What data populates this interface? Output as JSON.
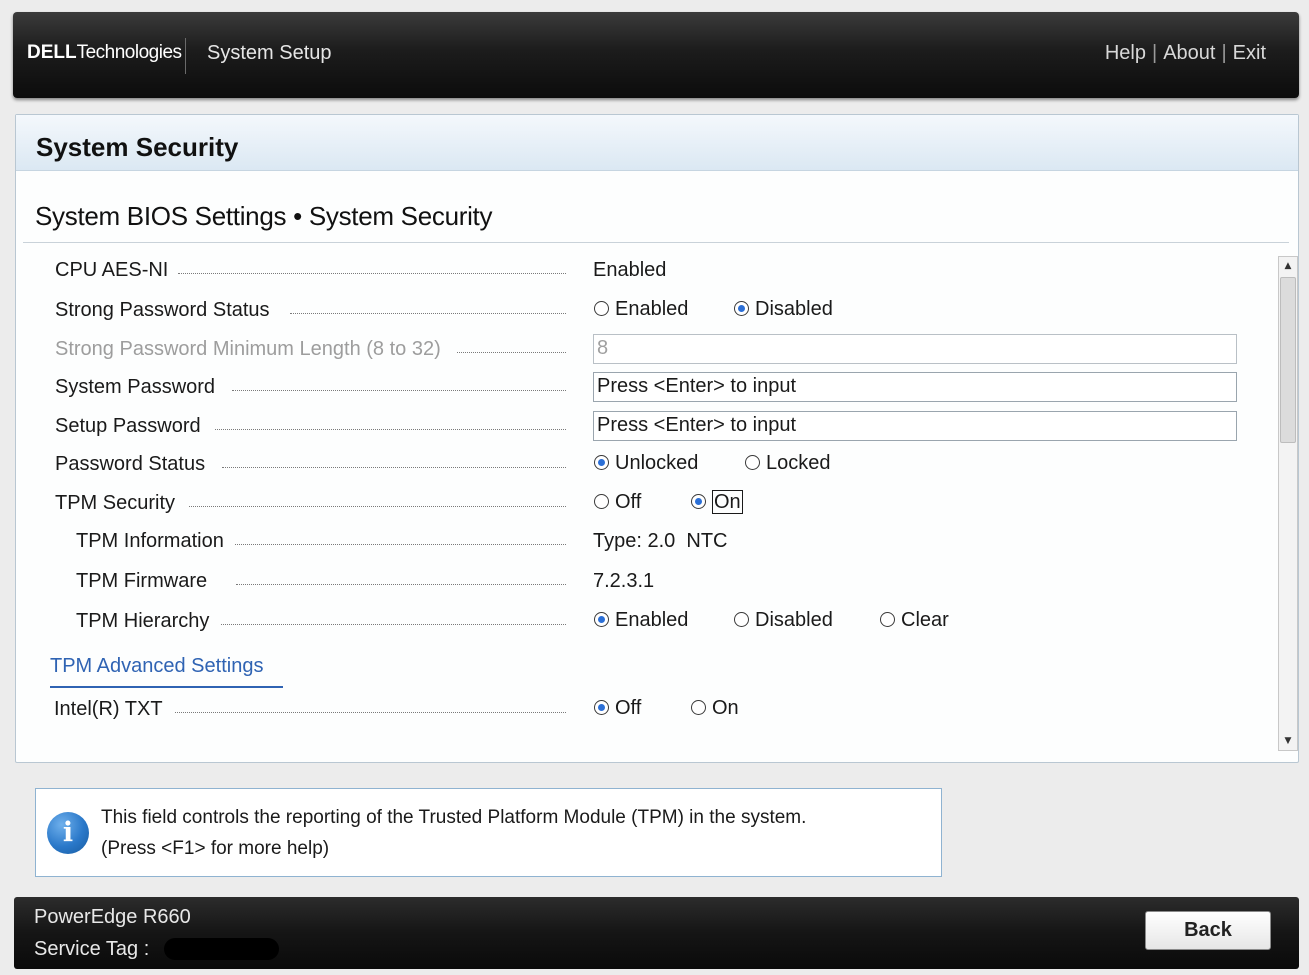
{
  "header": {
    "brand_bold": "DELL",
    "brand_rest": "Technologies",
    "app_title": "System Setup",
    "nav": {
      "help": "Help",
      "about": "About",
      "exit": "Exit",
      "separator": "|"
    }
  },
  "panel": {
    "title": "System Security",
    "breadcrumb": "System BIOS Settings • System Security"
  },
  "settings": {
    "cpu_aes_ni": {
      "label": "CPU AES-NI",
      "value": "Enabled"
    },
    "strong_password_status": {
      "label": "Strong Password Status",
      "options": [
        "Enabled",
        "Disabled"
      ],
      "selected": "Disabled"
    },
    "strong_password_min_length": {
      "label": "Strong Password Minimum Length (8 to 32)",
      "value": "8",
      "disabled": true
    },
    "system_password": {
      "label": "System Password",
      "value": "Press <Enter> to input"
    },
    "setup_password": {
      "label": "Setup Password",
      "value": "Press <Enter> to input"
    },
    "password_status": {
      "label": "Password Status",
      "options": [
        "Unlocked",
        "Locked"
      ],
      "selected": "Unlocked"
    },
    "tpm_security": {
      "label": "TPM Security",
      "options": [
        "Off",
        "On"
      ],
      "selected": "On"
    },
    "tpm_information": {
      "label": "TPM Information",
      "value": "Type: 2.0  NTC"
    },
    "tpm_firmware": {
      "label": "TPM Firmware",
      "value": "7.2.3.1"
    },
    "tpm_hierarchy": {
      "label": "TPM Hierarchy",
      "options": [
        "Enabled",
        "Disabled",
        "Clear"
      ],
      "selected": "Enabled"
    },
    "tpm_advanced_link": "TPM Advanced Settings",
    "intel_txt": {
      "label": "Intel(R) TXT",
      "options": [
        "Off",
        "On"
      ],
      "selected": "Off"
    }
  },
  "help": {
    "line1": "This field controls the reporting of the Trusted Platform Module (TPM) in the system.",
    "line2": "(Press <F1> for more help)"
  },
  "footer": {
    "model": "PowerEdge R660",
    "service_tag_label": "Service Tag :",
    "back_button": "Back"
  },
  "colors": {
    "accent_link": "#2f63b3",
    "radio_selected": "#2b6fd6",
    "header_bg": "#1c1c1c",
    "panel_head": "#dbe8f3"
  }
}
